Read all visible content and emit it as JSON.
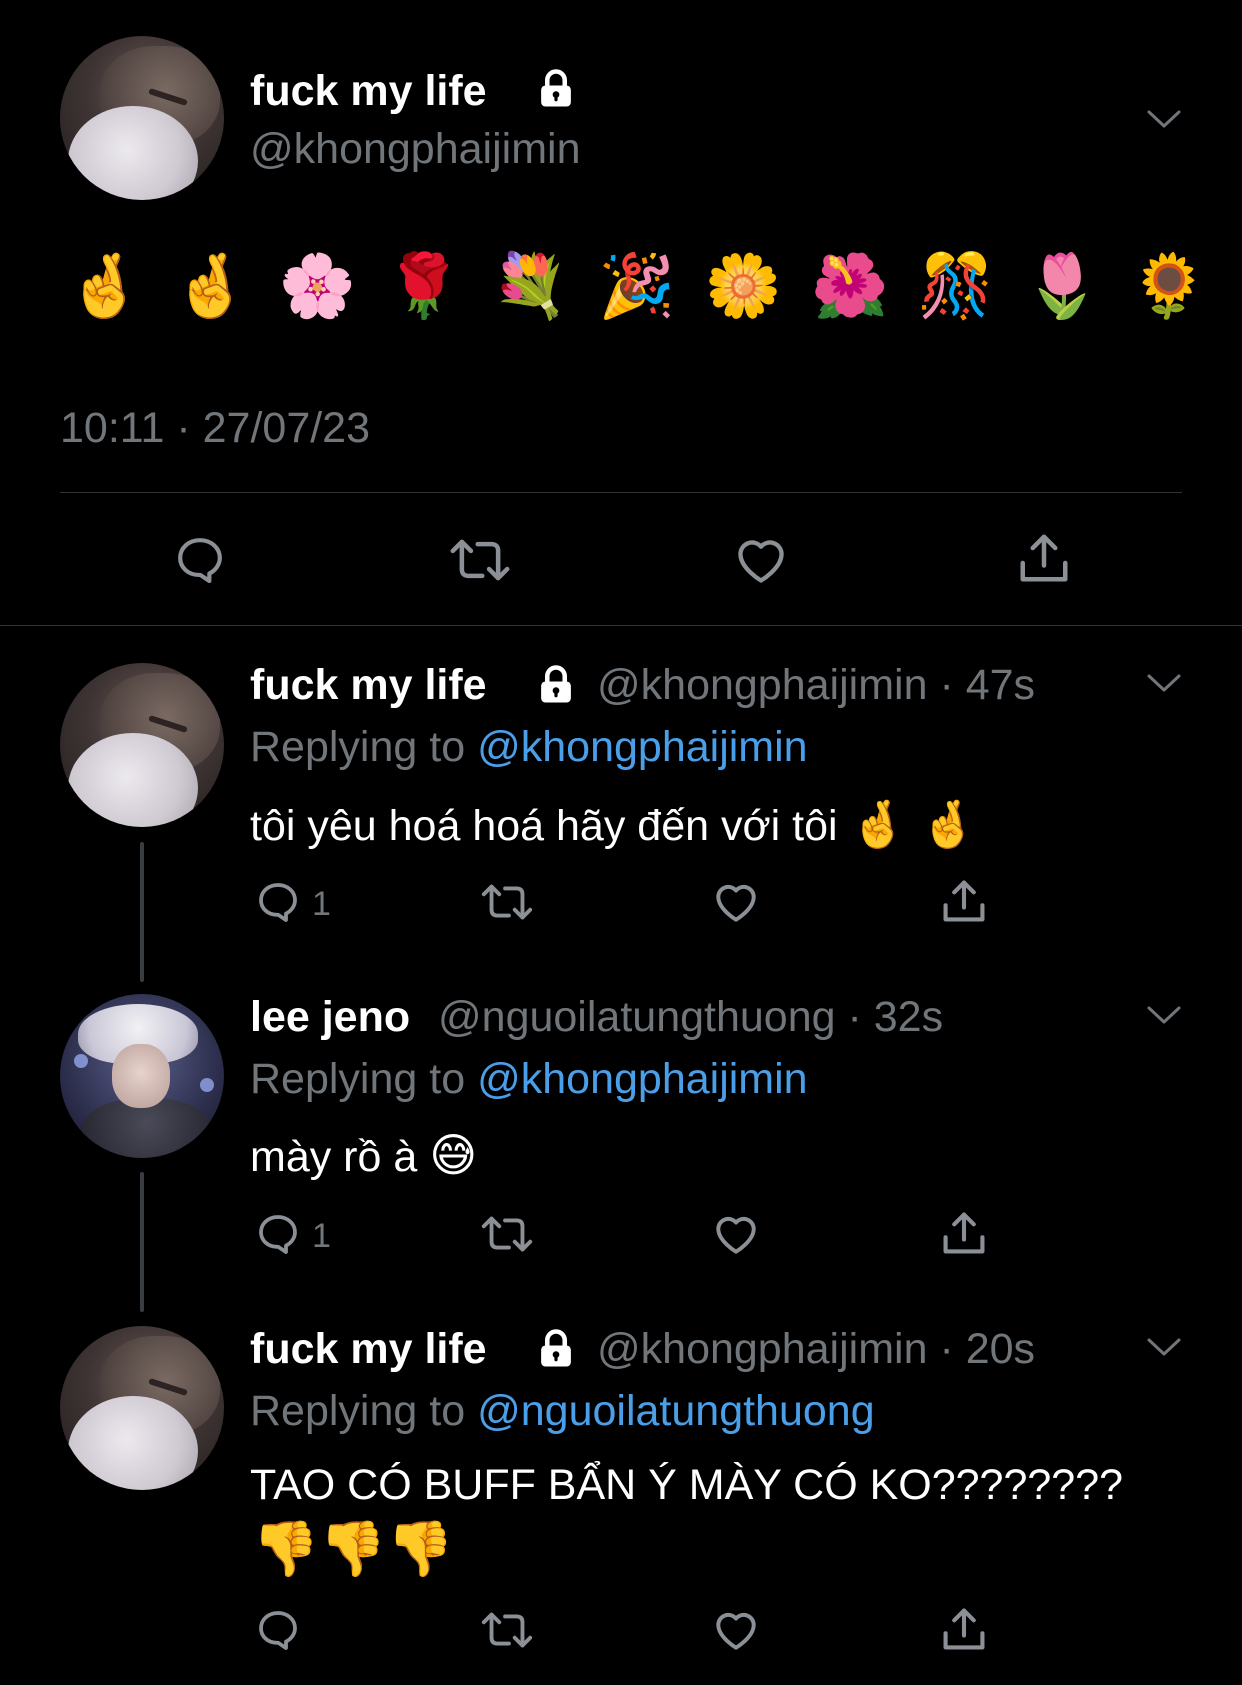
{
  "main_tweet": {
    "author_name": "fuck my life",
    "author_handle": "@khongphaijimin",
    "emojis": "🤞 🤞 🌸 🌹 💐 🎉 🌼 🌺 🎊 🌷 🌻",
    "timestamp": "10:11 · 27/07/23",
    "icons": [
      "lock-icon",
      "chevron-down-icon",
      "reply-icon",
      "retweet-icon",
      "like-icon",
      "share-icon"
    ]
  },
  "replies": [
    {
      "author_name": "fuck my life",
      "author_handle": "@khongphaijimin",
      "time": "· 47s",
      "replying_label": "Replying to",
      "replying_to": "@khongphaijimin",
      "text": "tôi yêu hoá hoá hãy đến với tôi",
      "text_emojis": "🤞 🤞",
      "reply_count": "1",
      "protected": true
    },
    {
      "author_name": "lee jeno",
      "author_handle": "@nguoilatungthuong",
      "time": "· 32s",
      "replying_label": "Replying to",
      "replying_to": "@khongphaijimin",
      "text": "mày rồ à",
      "text_emojis": "😅",
      "reply_count": "1",
      "protected": false
    },
    {
      "author_name": "fuck my life",
      "author_handle": "@khongphaijimin",
      "time": "· 20s",
      "replying_label": "Replying to",
      "replying_to": "@nguoilatungthuong",
      "text": "TAO CÓ BUFF BẨN Ý MÀY CÓ KO????????",
      "text_emojis": "👎👎👎",
      "reply_count": "",
      "protected": true
    }
  ],
  "colors": {
    "background": "#000000",
    "primary_text": "#ffffff",
    "secondary_text": "#71767b",
    "mention": "#4a9fe8",
    "divider": "#2f3336"
  }
}
